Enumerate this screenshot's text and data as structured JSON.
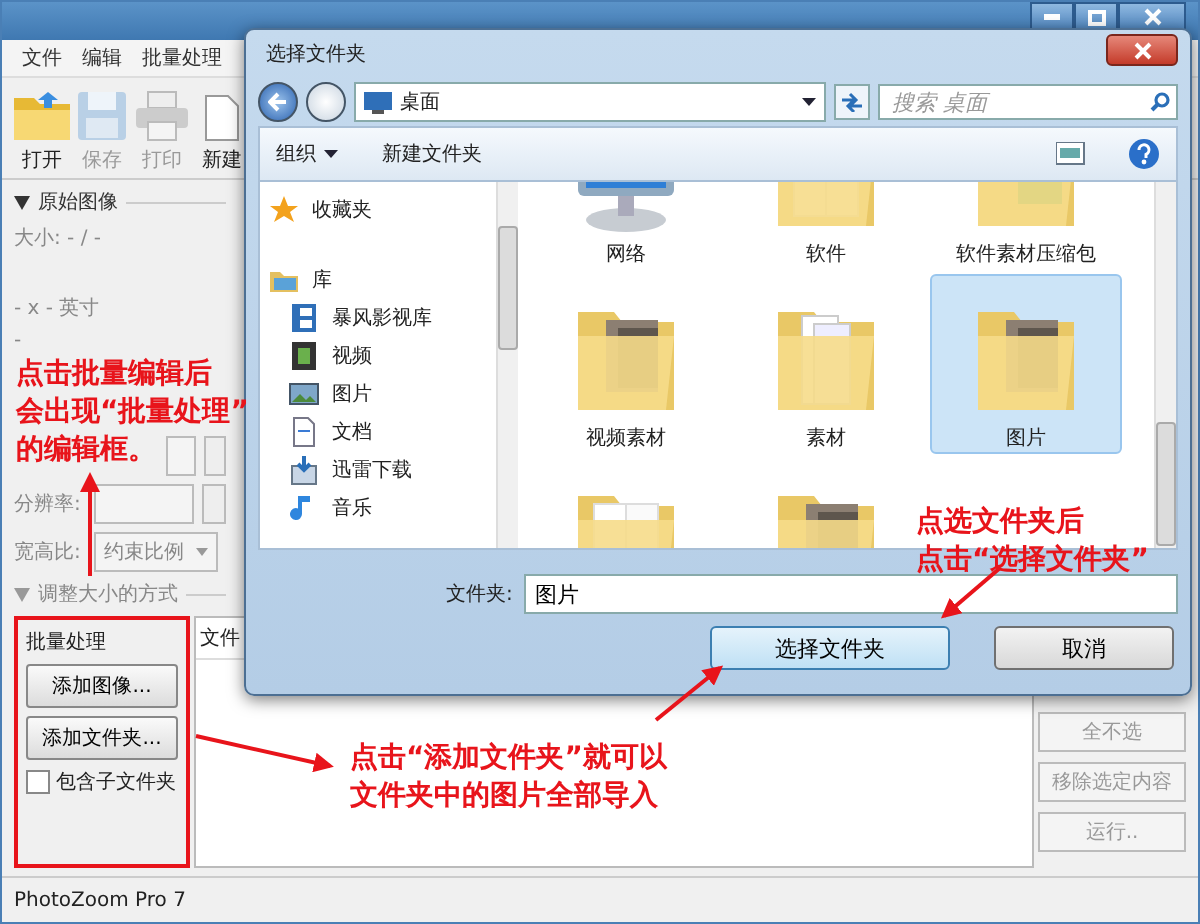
{
  "app": {
    "menu": [
      "文件",
      "编辑",
      "批量处理"
    ],
    "toolbar": [
      {
        "label": "打开",
        "disabled": false,
        "kind": "open"
      },
      {
        "label": "保存",
        "disabled": true,
        "kind": "save"
      },
      {
        "label": "打印",
        "disabled": true,
        "kind": "print"
      },
      {
        "label": "新建",
        "disabled": false,
        "kind": "new"
      }
    ],
    "original_image": {
      "heading": "原始图像",
      "size": "大小: - / -",
      "dimensions": "- x - 英寸",
      "extra": "-"
    },
    "fields": [
      {
        "kind": "partial"
      },
      {
        "kind": "full",
        "label": "分辨率:"
      }
    ],
    "aspect": {
      "label": "宽高比:",
      "value": "约束比例"
    },
    "resize_heading": "调整大小的方式",
    "batch": {
      "title": "批量处理",
      "buttons": [
        "添加图像...",
        "添加文件夹..."
      ],
      "checkbox": {
        "label": "包含子文件夹",
        "checked": false
      }
    },
    "list": {
      "columns": [
        "文件"
      ]
    },
    "side_buttons": [
      {
        "label": "全不选",
        "disabled": true
      },
      {
        "label": "移除选定内容",
        "disabled": true
      },
      {
        "label": "运行..",
        "disabled": true
      }
    ],
    "status_bar": "PhotoZoom Pro 7"
  },
  "dialog": {
    "title": "选择文件夹",
    "address": "桌面",
    "search": {
      "placeholder": "搜索 桌面"
    },
    "toolbar": [
      "组织",
      "新建文件夹"
    ],
    "nav": [
      {
        "label": "收藏夹",
        "kind": "favorites"
      },
      {
        "label": "库",
        "kind": "library",
        "children": [
          {
            "label": "暴风影视库",
            "kind": "movies"
          },
          {
            "label": "视频",
            "kind": "video"
          },
          {
            "label": "图片",
            "kind": "pictures"
          },
          {
            "label": "文档",
            "kind": "documents"
          },
          {
            "label": "迅雷下载",
            "kind": "download"
          },
          {
            "label": "音乐",
            "kind": "music"
          }
        ]
      }
    ],
    "items": [
      {
        "label": "网络",
        "kind": "network",
        "selected": false
      },
      {
        "label": "软件",
        "kind": "folder",
        "selected": false
      },
      {
        "label": "软件素材压缩包",
        "kind": "archive",
        "selected": false
      },
      {
        "label": "视频素材",
        "kind": "photo-folder",
        "selected": false
      },
      {
        "label": "素材",
        "kind": "docs-folder",
        "selected": false
      },
      {
        "label": "图片",
        "kind": "photo-folder",
        "selected": true
      },
      {
        "kind": "folder",
        "selected": false
      },
      {
        "kind": "photo-folder",
        "selected": false
      }
    ],
    "folder_field": {
      "label": "文件夹:",
      "value": "图片"
    },
    "buttons": [
      {
        "label": "选择文件夹",
        "default": true
      },
      {
        "label": "取消",
        "default": false
      }
    ]
  },
  "annotations": [
    {
      "lines": [
        "点击批量编辑后",
        "会出现“批量处理”",
        "的编辑框。"
      ]
    },
    {
      "lines": [
        "点选文件夹后",
        "点击“选择文件夹”"
      ]
    },
    {
      "lines": [
        "点击“添加文件夹”就可以",
        "文件夹中的图片全部导入"
      ]
    }
  ]
}
